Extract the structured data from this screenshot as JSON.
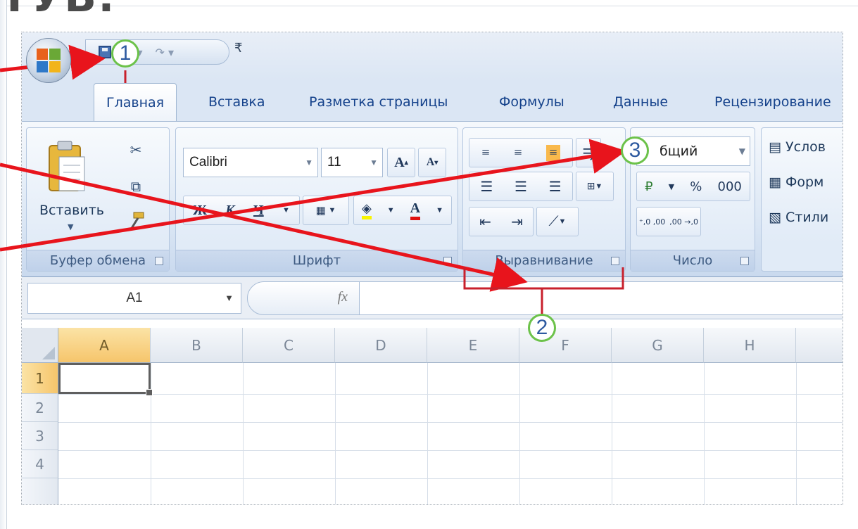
{
  "slide": {
    "title": "ТУВ:"
  },
  "colors": {
    "annotation_arrow": "#e8141c",
    "badge_ring": "#6cc24a",
    "selected_header": "#f6c56b"
  },
  "qat": {
    "icons": [
      "save-icon",
      "undo-icon",
      "redo-icon"
    ],
    "customize_glyph": "₹"
  },
  "tabs": [
    {
      "label": "Главная",
      "active": true
    },
    {
      "label": "Вставка"
    },
    {
      "label": "Разметка страницы"
    },
    {
      "label": "Формулы"
    },
    {
      "label": "Данные"
    },
    {
      "label": "Рецензирование"
    }
  ],
  "ribbon": {
    "clipboard": {
      "label": "Буфер обмена",
      "paste_label": "Вставить"
    },
    "font": {
      "label": "Шрифт",
      "font_name": "Calibri",
      "font_size": "11",
      "bold": "Ж",
      "italic": "К",
      "underline": "Ч",
      "grow": "A",
      "shrink": "A",
      "color_letter": "A"
    },
    "alignment": {
      "label": "Выравнивание"
    },
    "number": {
      "label": "Число",
      "format": "бщий",
      "percent": "%",
      "thousands": "000",
      "inc_decimal": "⁺,0 ,00",
      "dec_decimal": ",00 →,0"
    },
    "styles": {
      "items": [
        "Услов",
        "Форм",
        "Стили"
      ]
    }
  },
  "formula_bar": {
    "cell_ref": "A1",
    "fx": "fx"
  },
  "grid": {
    "columns": [
      "A",
      "B",
      "C",
      "D",
      "E",
      "F",
      "G",
      "H"
    ],
    "rows": [
      "1",
      "2",
      "3",
      "4"
    ],
    "selected_cell": "A1"
  },
  "annotations": [
    {
      "label": "1"
    },
    {
      "label": "2"
    },
    {
      "label": "3"
    }
  ]
}
